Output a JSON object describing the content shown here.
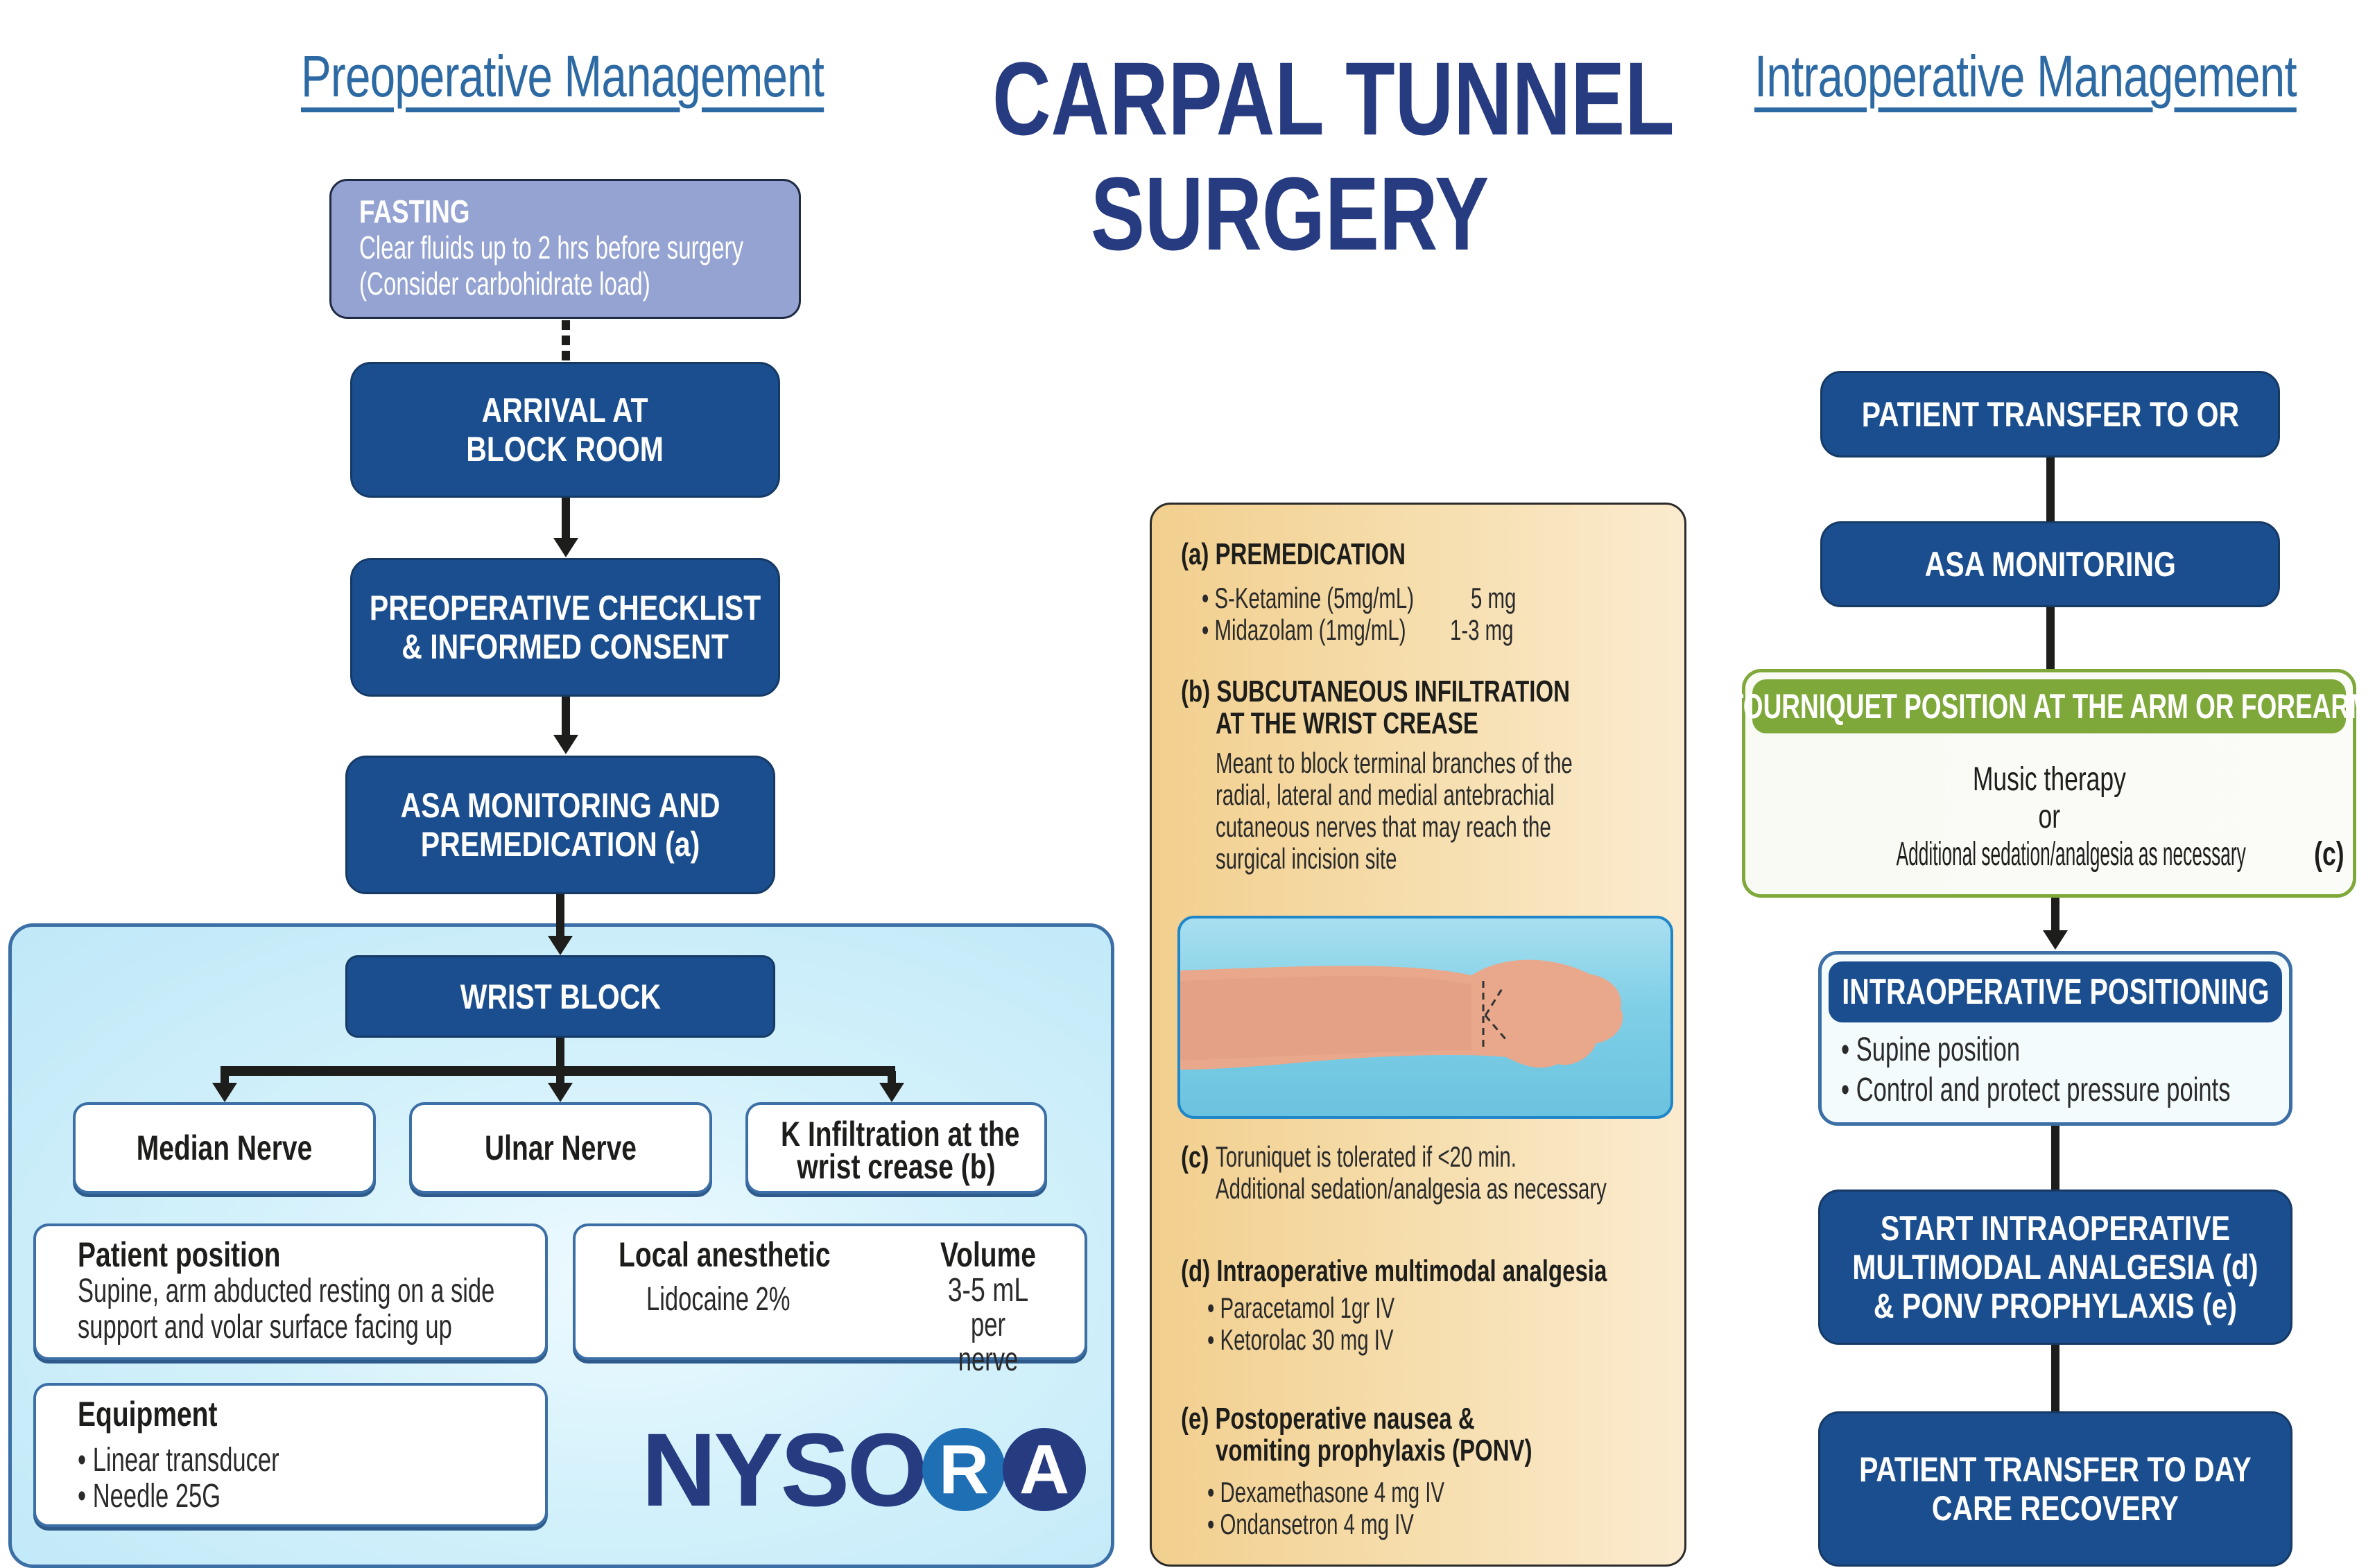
{
  "headings": {
    "preoperative": "Preoperative Management",
    "title_line1": "CARPAL TUNNEL",
    "title_line2": "SURGERY",
    "intraoperative": "Intraoperative Management"
  },
  "colors": {
    "primary_box": "#1b4e8e",
    "heading_blue": "#2d6aa3",
    "title_navy": "#273b80",
    "fasting_box": "#94a3d1",
    "tourniquet_green": "#7fa83a",
    "wrist_panel": "#cdeefa",
    "notes_panel": "#f4d9a4"
  },
  "preop": {
    "fasting": {
      "title": "FASTING",
      "line1": "Clear fluids up to 2 hrs before surgery",
      "line2": "(Consider carbohidrate load)"
    },
    "steps": [
      {
        "line1": "ARRIVAL AT",
        "line2": "BLOCK ROOM"
      },
      {
        "line1": "PREOPERATIVE CHECKLIST",
        "line2": "& INFORMED CONSENT"
      },
      {
        "line1": "ASA MONITORING AND",
        "line2": "PREMEDICATION (a)"
      }
    ],
    "wrist_block": {
      "title": "WRIST BLOCK",
      "targets": [
        {
          "line1": "Median Nerve",
          "line2": ""
        },
        {
          "line1": "Ulnar Nerve",
          "line2": ""
        },
        {
          "line1": "K  Infiltration at the",
          "line2": "wrist crease (b)"
        }
      ],
      "patient_position": {
        "title": "Patient position",
        "line1": "Supine, arm abducted resting on a side",
        "line2": "support and volar surface facing up"
      },
      "local_anesthetic": {
        "title": "Local anesthetic",
        "value": "Lidocaine 2%",
        "volume_title": "Volume",
        "volume_value": "3-5 mL",
        "volume_unit": "per nerve"
      },
      "equipment": {
        "title": "Equipment",
        "items": [
          "Linear transducer",
          "Needle 25G"
        ]
      }
    },
    "logo": {
      "text": "NYSO",
      "circle1": "R",
      "circle2": "A",
      "circle1_color": "#1f6fb5",
      "circle2_color": "#273b80"
    }
  },
  "notes": {
    "a": {
      "label": "(a)",
      "title": "PREMEDICATION",
      "items": [
        {
          "drug": "S-Ketamine (5mg/mL)",
          "dose": "5 mg"
        },
        {
          "drug": "Midazolam (1mg/mL)",
          "dose": "1-3 mg"
        }
      ]
    },
    "b": {
      "label": "(b)",
      "title_line1": "SUBCUTANEOUS INFILTRATION",
      "title_line2": "AT THE WRIST CREASE",
      "body": [
        "Meant to block terminal branches of the",
        "radial, lateral and medial antebrachial",
        "cutaneous nerves that may reach the",
        "surgical incision site"
      ]
    },
    "photo_alt": "Forearm and wrist with dashed infiltration lines at wrist crease",
    "c": {
      "label": "(c)",
      "line1": "Toruniquet is tolerated  if <20 min.",
      "line2": "Additional sedation/analgesia as necessary"
    },
    "d": {
      "label": "(d)",
      "title": "Intraoperative multimodal analgesia",
      "items": [
        "Paracetamol 1gr IV",
        "Ketorolac 30 mg IV"
      ]
    },
    "e": {
      "label": "(e)",
      "title_line1": "Postoperative nausea &",
      "title_line2": "vomiting prophylaxis (PONV)",
      "items": [
        "Dexamethasone 4 mg IV",
        "Ondansetron 4 mg IV"
      ]
    }
  },
  "intraop": {
    "transfer_or": "PATIENT TRANSFER TO OR",
    "asa_monitoring": "ASA MONITORING",
    "tourniquet": {
      "title": "TOURNIQUET POSITION AT THE ARM OR FOREARM",
      "line1": "Music therapy",
      "line2": "or",
      "line3": "Additional sedation/analgesia as necessary",
      "line3_ref": "(c)"
    },
    "positioning": {
      "title": "INTRAOPERATIVE POSITIONING",
      "items": [
        "Supine position",
        "Control and protect pressure points"
      ]
    },
    "start_analgesia": {
      "line1": "START INTRAOPERATIVE",
      "line2": "MULTIMODAL ANALGESIA (d)",
      "line3": "& PONV PROPHYLAXIS (e)"
    },
    "day_care": {
      "line1": "PATIENT TRANSFER TO DAY",
      "line2": "CARE RECOVERY"
    }
  }
}
